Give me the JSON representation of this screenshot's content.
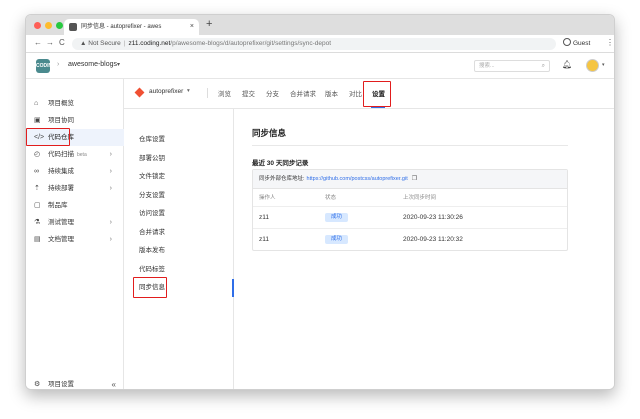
{
  "browser": {
    "tab_title": "同步信息 - autoprefixer - awes",
    "tab_close": "×",
    "new_tab": "+",
    "back": "←",
    "forward": "→",
    "reload": "C",
    "security_label": "Not Secure",
    "url_host": "z11.coding.net",
    "url_path": "/p/awesome-blogs/d/autoprefixer/git/settings/sync-depot",
    "guest_label": "Guest",
    "menu": "⋮"
  },
  "header": {
    "logo_text": "CODING",
    "crumb_chevron": "›",
    "project_name": "awesome-blogs",
    "project_caret": "▾",
    "search_placeholder": "搜索...",
    "bell": "♫",
    "user_caret": "▾"
  },
  "sidebar": {
    "items": [
      {
        "icon": "⌂",
        "label": "项目概览"
      },
      {
        "icon": "▣",
        "label": "项目协同"
      },
      {
        "icon": "</>",
        "label": "代码仓库"
      },
      {
        "icon": "◴",
        "label": "代码扫描",
        "badge": "beta",
        "arrow": "›"
      },
      {
        "icon": "∞",
        "label": "持续集成",
        "arrow": "›"
      },
      {
        "icon": "⇡",
        "label": "持续部署",
        "arrow": "›"
      },
      {
        "icon": "▢",
        "label": "制品库"
      },
      {
        "icon": "⚗",
        "label": "测试管理",
        "arrow": "›"
      },
      {
        "icon": "▤",
        "label": "文档管理",
        "arrow": "›"
      }
    ],
    "settings_label": "项目设置",
    "settings_icon": "⚙",
    "collapse": "«"
  },
  "repo": {
    "name": "autoprefixer",
    "caret": "▾",
    "tabs": [
      "浏览",
      "提交",
      "分支",
      "合并请求",
      "版本",
      "对比",
      "设置"
    ]
  },
  "subnav": {
    "items": [
      "仓库设置",
      "部署公钥",
      "文件锁定",
      "分支设置",
      "访问设置",
      "合并请求",
      "版本发布",
      "代码标签",
      "同步信息"
    ]
  },
  "main": {
    "page_title": "同步信息",
    "section_title": "最近 30 天同步记录",
    "remote_label": "同步外部仓库地址:",
    "remote_url": "https://github.com/postcss/autoprefixer.git",
    "copy_icon": "❐",
    "columns": [
      "操作人",
      "状态",
      "上次同步时间"
    ],
    "rows": [
      {
        "user": "z11",
        "status": "成功",
        "time": "2020-09-23 11:30:26"
      },
      {
        "user": "z11",
        "status": "成功",
        "time": "2020-09-23 11:20:32"
      }
    ]
  },
  "colors": {
    "accent": "#2f6ee8",
    "highlight": "#e11d1d",
    "badge_bg": "#d7e8ff"
  }
}
